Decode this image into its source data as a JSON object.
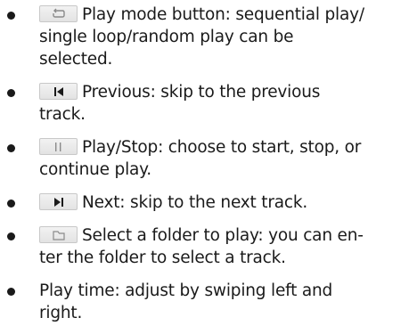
{
  "items": [
    {
      "icon": "play-mode-icon",
      "lines": [
        "Play mode button: sequential play/",
        "single loop/random play can be",
        "selected."
      ]
    },
    {
      "icon": "previous-icon",
      "lines": [
        "Previous: skip to the previous",
        "track."
      ]
    },
    {
      "icon": "play-pause-icon",
      "lines": [
        "Play/Stop: choose to start, stop, or",
        "continue play."
      ]
    },
    {
      "icon": "next-icon",
      "lines": [
        "Next: skip to the next track."
      ]
    },
    {
      "icon": "folder-icon",
      "lines": [
        "Select a folder to play: you can en-",
        "ter the folder to select a track."
      ]
    },
    {
      "icon": "",
      "lines": [
        "Play time: adjust by swiping left and",
        "right."
      ]
    }
  ]
}
